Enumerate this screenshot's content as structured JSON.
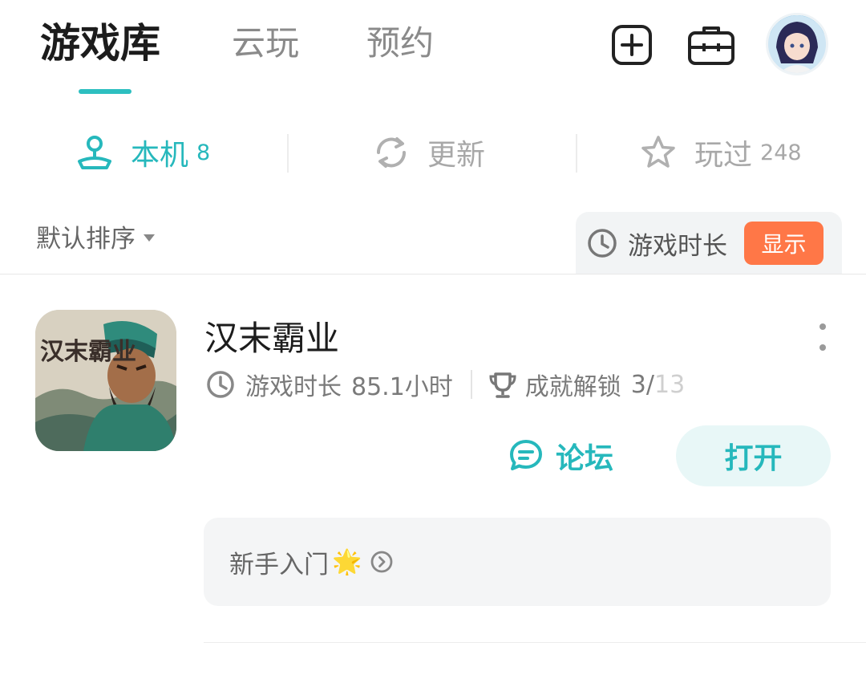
{
  "header": {
    "tabs": [
      {
        "label": "游戏库",
        "active": true
      },
      {
        "label": "云玩",
        "active": false
      },
      {
        "label": "预约",
        "active": false
      }
    ],
    "icons": [
      "add-icon",
      "toolbox-icon",
      "avatar"
    ]
  },
  "subtabs": [
    {
      "icon": "joystick-icon",
      "label": "本机",
      "count": "8",
      "active": true
    },
    {
      "icon": "refresh-icon",
      "label": "更新",
      "count": "",
      "active": false
    },
    {
      "icon": "star-icon",
      "label": "玩过",
      "count": "248",
      "active": false
    }
  ],
  "filter": {
    "sort_label": "默认排序",
    "playtime_label": "游戏时长",
    "show_button": "显示"
  },
  "game": {
    "title": "汉末霸业",
    "playtime_label": "游戏时长",
    "playtime_value": "85.1小时",
    "achievement_label": "成就解锁",
    "achievement_unlocked": "3",
    "achievement_total": "13",
    "forum_label": "论坛",
    "open_label": "打开",
    "guide_label": "新手入门",
    "guide_emoji": "🌟",
    "icon_text": "汉末霸业"
  },
  "colors": {
    "accent": "#26b8bc",
    "orange": "#ff7747",
    "panel": "#f4f5f6"
  }
}
